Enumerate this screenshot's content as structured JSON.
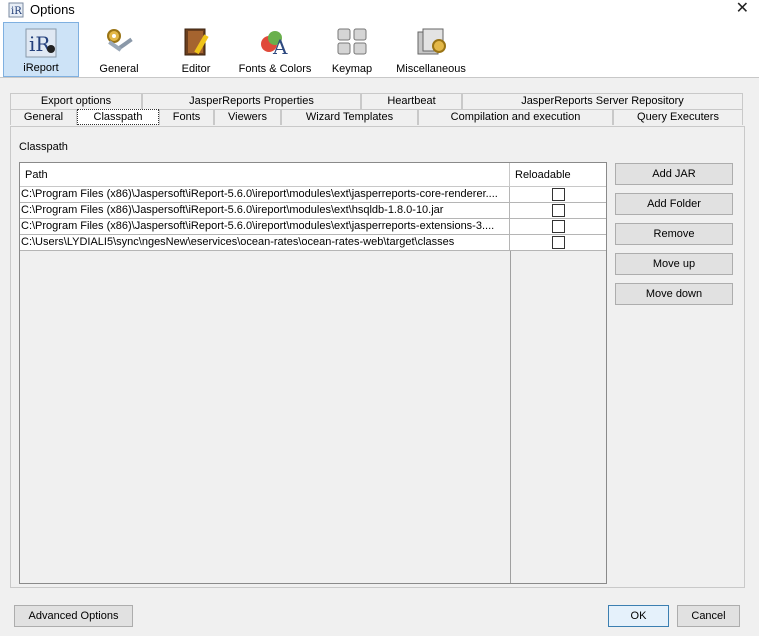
{
  "window": {
    "title": "Options",
    "close_glyph": "✕"
  },
  "toolbar": {
    "items": [
      {
        "label": "iReport",
        "icon": "ireport-logo-icon",
        "active": true
      },
      {
        "label": "General",
        "icon": "gears-icon"
      },
      {
        "label": "Editor",
        "icon": "book-pencil-icon"
      },
      {
        "label": "Fonts & Colors",
        "icon": "fonts-colors-icon"
      },
      {
        "label": "Keymap",
        "icon": "keyboard-icon"
      },
      {
        "label": "Miscellaneous",
        "icon": "misc-icon"
      }
    ]
  },
  "tabs": {
    "row1": [
      "Export options",
      "JasperReports Properties",
      "Heartbeat",
      "JasperReports Server Repository"
    ],
    "row2": [
      "General",
      "Classpath",
      "Fonts",
      "Viewers",
      "Wizard Templates",
      "Compilation and execution",
      "Query Executers"
    ],
    "active": "Classpath"
  },
  "classpath": {
    "section_label": "Classpath",
    "columns": {
      "path": "Path",
      "reloadable": "Reloadable"
    },
    "rows": [
      {
        "path": "C:\\Program Files (x86)\\Jaspersoft\\iReport-5.6.0\\ireport\\modules\\ext\\jasperreports-core-renderer....",
        "reloadable": false
      },
      {
        "path": "C:\\Program Files (x86)\\Jaspersoft\\iReport-5.6.0\\ireport\\modules\\ext\\hsqldb-1.8.0-10.jar",
        "reloadable": false
      },
      {
        "path": "C:\\Program Files (x86)\\Jaspersoft\\iReport-5.6.0\\ireport\\modules\\ext\\jasperreports-extensions-3....",
        "reloadable": false
      },
      {
        "path": "C:\\Users\\LYDIALI5\\sync\\ngesNew\\eservices\\ocean-rates\\ocean-rates-web\\target\\classes",
        "reloadable": false
      }
    ],
    "buttons": {
      "add_jar": "Add JAR",
      "add_folder": "Add Folder",
      "remove": "Remove",
      "move_up": "Move up",
      "move_down": "Move down"
    }
  },
  "footer": {
    "advanced": "Advanced Options",
    "ok": "OK",
    "cancel": "Cancel"
  }
}
